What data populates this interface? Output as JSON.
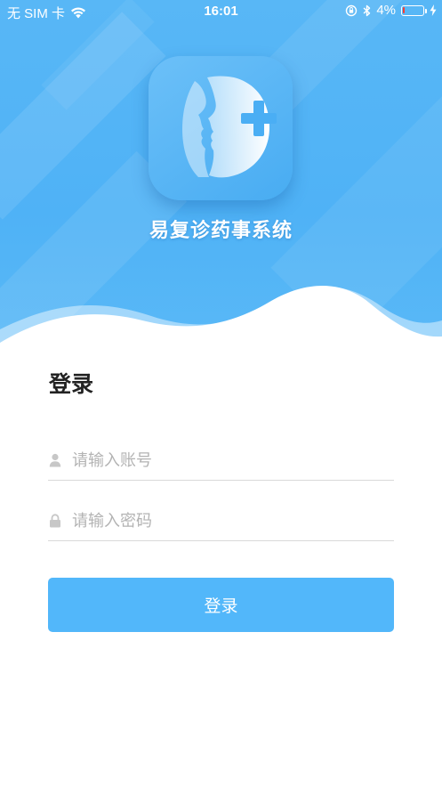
{
  "status_bar": {
    "carrier": "无 SIM 卡",
    "time": "16:01",
    "battery_percent": "4%",
    "battery_level": 0.04
  },
  "app": {
    "name": "易复诊药事系统",
    "logo_icon": "face-profile-plus-icon"
  },
  "login": {
    "heading": "登录",
    "account_placeholder": "请输入账号",
    "account_value": "",
    "password_placeholder": "请输入密码",
    "password_value": "",
    "submit_label": "登录"
  },
  "colors": {
    "primary": "#52b7fa",
    "header": "#4fb2f6",
    "placeholder": "#b3b3b3"
  }
}
